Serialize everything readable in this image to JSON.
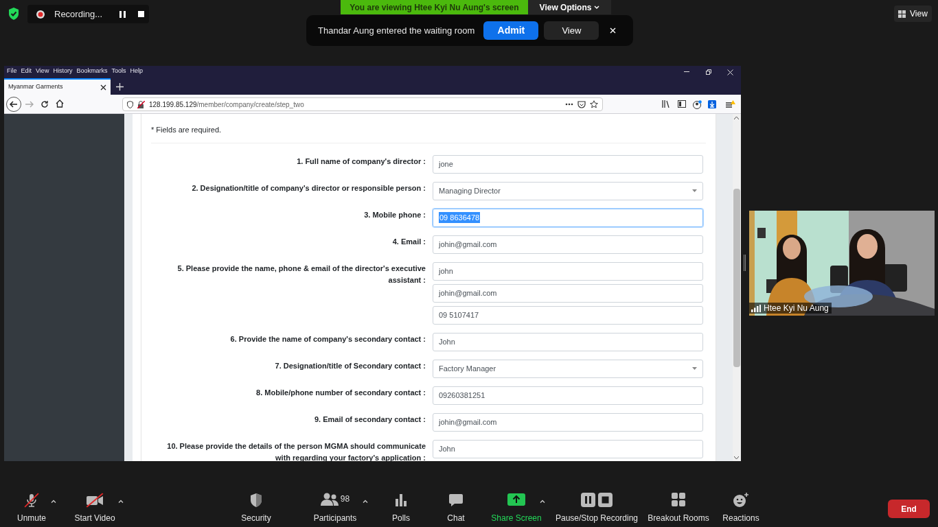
{
  "meeting": {
    "encrypted": true,
    "recording": {
      "label": "Recording..."
    },
    "sharing_banner": "You are viewing Htee Kyi Nu Aung's screen",
    "view_options": "View Options",
    "view_button": "View"
  },
  "notification": {
    "message": "Thandar Aung entered the waiting room",
    "buttons": [
      {
        "label": "Admit",
        "primary": true
      },
      {
        "label": "View",
        "primary": false
      }
    ]
  },
  "browser": {
    "menu": [
      "File",
      "Edit",
      "View",
      "History",
      "Bookmarks",
      "Tools",
      "Help"
    ],
    "tab": {
      "title": "Myanmar Garments"
    },
    "address": {
      "host": "128.199.85.129",
      "path": "/member/company/create/step_two"
    },
    "form": {
      "note": "* Fields are required.",
      "fields": [
        {
          "label": "1. Full name of company's director :",
          "kind": "text",
          "values": [
            "jone"
          ],
          "focused": false
        },
        {
          "label": "2. Designation/title of company's director or responsible person :",
          "kind": "select",
          "values": [
            "Managing Director"
          ],
          "focused": false
        },
        {
          "label": "3. Mobile phone :",
          "kind": "text",
          "values": [
            "09 8636478"
          ],
          "focused": true
        },
        {
          "label": "4. Email :",
          "kind": "text",
          "values": [
            "johin@gmail.com"
          ],
          "focused": false
        },
        {
          "label": "5. Please provide the name, phone & email of the director's executive assistant :",
          "kind": "text",
          "values": [
            "john",
            "johin@gmail.com",
            "09 5107417"
          ],
          "focused": false
        },
        {
          "label": "6. Provide the name of company's secondary contact :",
          "kind": "text",
          "values": [
            "John"
          ],
          "focused": false
        },
        {
          "label": "7. Designation/title of Secondary contact :",
          "kind": "select",
          "values": [
            "Factory Manager"
          ],
          "focused": false
        },
        {
          "label": "8. Mobile/phone number of secondary contact :",
          "kind": "text",
          "values": [
            "09260381251"
          ],
          "focused": false
        },
        {
          "label": "9. Email of secondary contact :",
          "kind": "text",
          "values": [
            "johin@gmail.com"
          ],
          "focused": false
        },
        {
          "label": "10. Please provide the details of the person MGMA should communicate with regarding your factory's application :",
          "kind": "text",
          "values": [
            "John"
          ],
          "focused": false
        }
      ]
    }
  },
  "video": {
    "name": "Htee Kyi Nu Aung"
  },
  "toolbar": [
    {
      "kind": "mic",
      "label": "Unmute",
      "off": true,
      "menu": true,
      "active": false
    },
    {
      "kind": "camera",
      "label": "Start Video",
      "off": true,
      "menu": true,
      "active": false
    },
    {
      "kind": "security",
      "label": "Security",
      "off": false,
      "menu": false,
      "active": false
    },
    {
      "kind": "participants",
      "label": "Participants",
      "count": "98",
      "off": false,
      "menu": true,
      "active": false
    },
    {
      "kind": "polls",
      "label": "Polls",
      "off": false,
      "menu": false,
      "active": false
    },
    {
      "kind": "chat",
      "label": "Chat",
      "off": false,
      "menu": false,
      "active": false
    },
    {
      "kind": "share",
      "label": "Share Screen",
      "off": false,
      "menu": true,
      "active": true
    },
    {
      "kind": "record",
      "label": "Pause/Stop Recording",
      "off": false,
      "menu": false,
      "active": false
    },
    {
      "kind": "breakout",
      "label": "Breakout Rooms",
      "off": false,
      "menu": false,
      "active": false
    },
    {
      "kind": "reactions",
      "label": "Reactions",
      "off": false,
      "menu": false,
      "active": false
    }
  ],
  "end_button": "End"
}
